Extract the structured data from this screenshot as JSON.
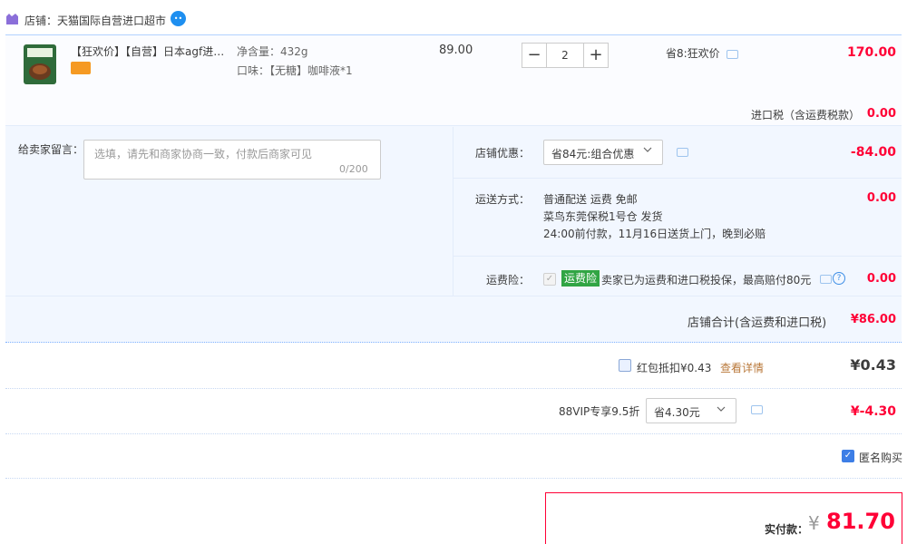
{
  "shop": {
    "label": "店铺：天猫国际自营进口超市"
  },
  "item": {
    "title": "【狂欢价】【自营】日本agf进口咖啡液",
    "spec_weight": "净含量：432g",
    "spec_flavor": "口味：【无糖】咖啡液*1",
    "unit_price": "89.00",
    "quantity": "2",
    "minus_label": "−",
    "plus_label": "+",
    "saving": "省8:狂欢价",
    "total": "170.00"
  },
  "tax": {
    "label": "进口税（含运费税款）",
    "value": "0.00"
  },
  "message": {
    "label": "给卖家留言：",
    "placeholder": "选填，请先和商家协商一致，付款后商家可见",
    "counter": "0/200"
  },
  "store_discount": {
    "label": "店铺优惠：",
    "selected": "省84元:组合优惠",
    "value": "-84.00"
  },
  "shipping": {
    "label": "运送方式：",
    "line1": "普通配送 运费 免邮",
    "line2": "菜鸟东莞保税1号仓   发货",
    "line3": "24:00前付款，11月16日送货上门，晚到必赔",
    "value": "0.00"
  },
  "insurance": {
    "label": "运费险：",
    "check_glyph": "✓",
    "badge": "运费险",
    "desc": "卖家已为运费和进口税投保，最高赔付80元",
    "help_glyph": "?",
    "value": "0.00"
  },
  "store_total": {
    "label": "店铺合计(含运费和进口税)",
    "value": "¥86.00"
  },
  "red_packet": {
    "label": "红包抵扣¥0.43",
    "detail_link": "查看详情",
    "value": "¥0.43"
  },
  "vip": {
    "label": "88VIP专享9.5折",
    "selected": "省4.30元",
    "value": "¥-4.30"
  },
  "anonymous": {
    "check_glyph": "✓",
    "label": "匿名购买"
  },
  "pay": {
    "label": "实付款：",
    "currency": "¥",
    "amount": "81.70"
  },
  "colors": {
    "accent_red": "#ff0036",
    "panel_bg": "#f2f7ff",
    "link_blue": "#3d7ee6",
    "badge_green": "#31a544"
  }
}
